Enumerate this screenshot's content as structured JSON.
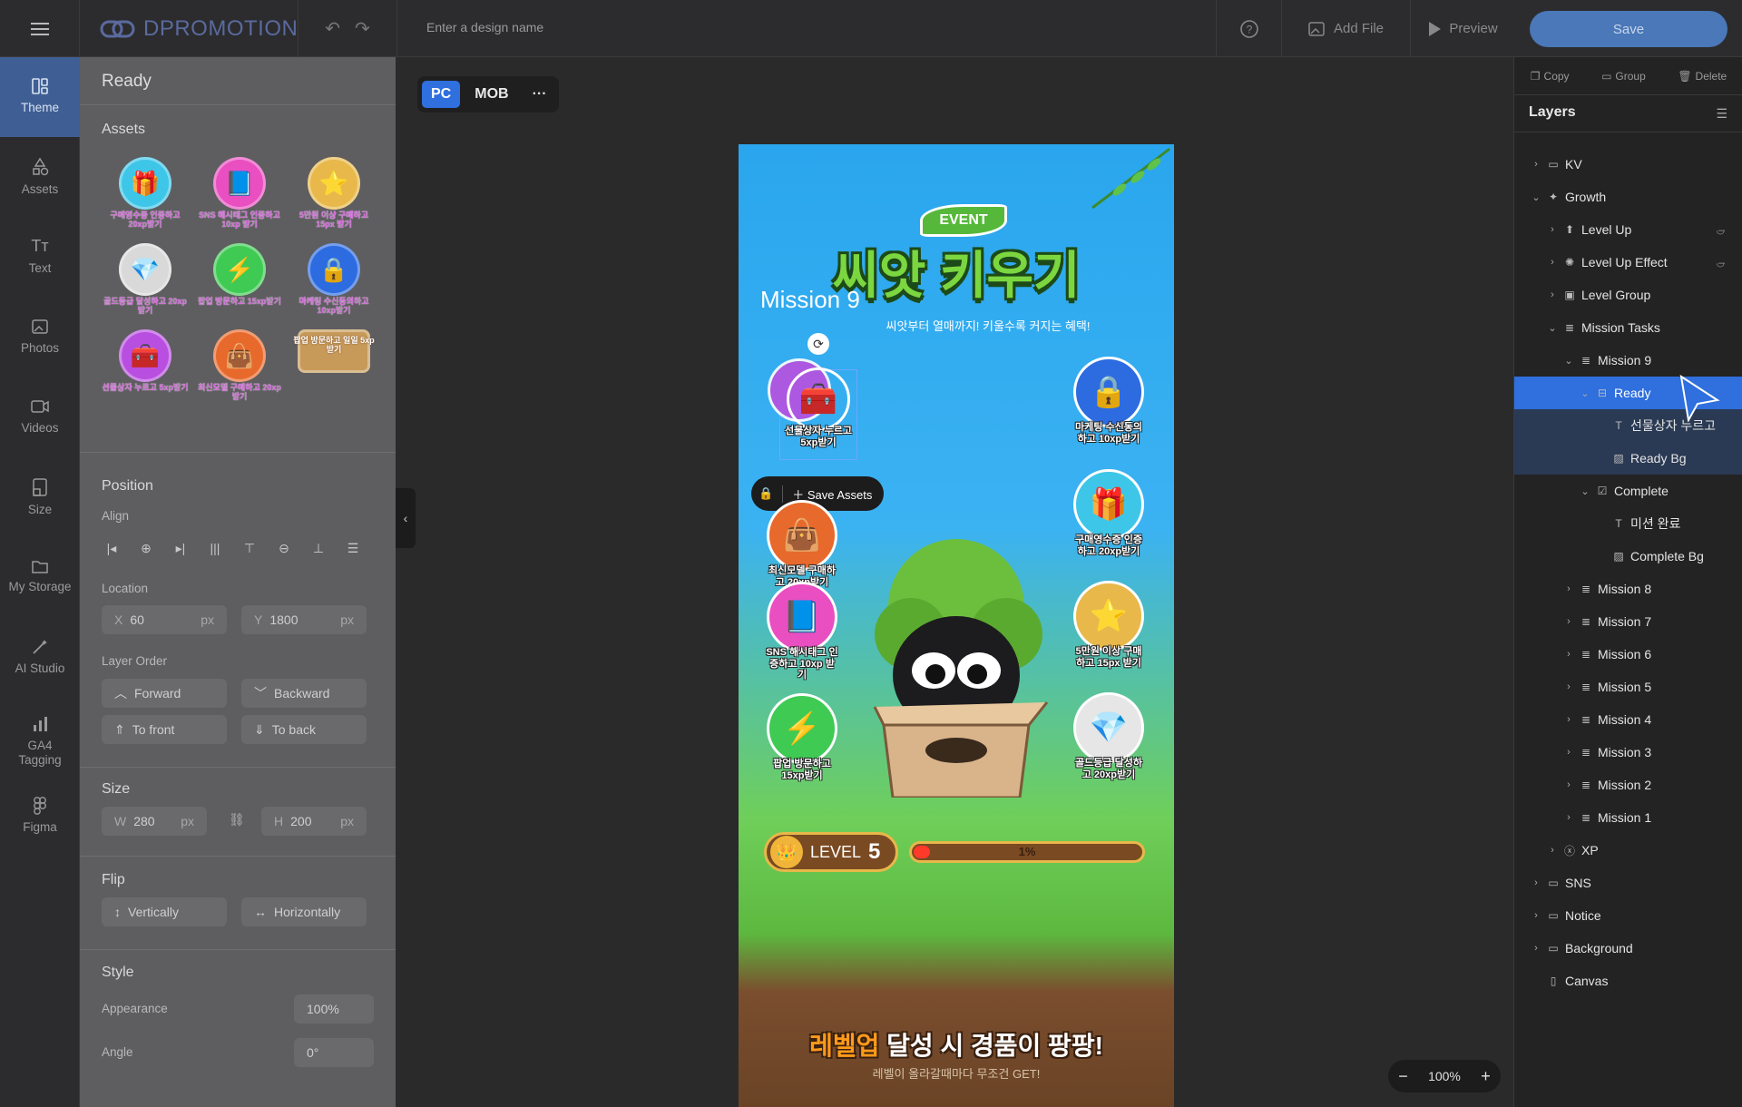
{
  "header": {
    "brand": "DPROMOTION",
    "design_name_placeholder": "Enter a design name",
    "add_file": "Add File",
    "preview": "Preview",
    "save": "Save"
  },
  "rail": [
    {
      "label": "Theme"
    },
    {
      "label": "Assets"
    },
    {
      "label": "Text"
    },
    {
      "label": "Photos"
    },
    {
      "label": "Videos"
    },
    {
      "label": "Size"
    },
    {
      "label": "My Storage"
    },
    {
      "label": "AI Studio"
    },
    {
      "label": "GA4 Tagging"
    },
    {
      "label": "Figma"
    }
  ],
  "panel": {
    "title": "Ready",
    "assets_heading": "Assets",
    "assets": [
      {
        "caption": "구매영수증 인증하고 20xp받기",
        "icon": "gift-icon",
        "color": "#3ec6e8"
      },
      {
        "caption": "SNS 해시태그 인증하고 10xp 받기",
        "icon": "book-icon",
        "color": "#e94fc1"
      },
      {
        "caption": "5만원 이상 구매하고 15px 받기",
        "icon": "star-coin-icon",
        "color": "#e8b84a"
      },
      {
        "caption": "골드등급 달성하고 20xp받기",
        "icon": "gem-icon",
        "color": "#d9d9d9"
      },
      {
        "caption": "팝업 방문하고 15xp받기",
        "icon": "lightning-icon",
        "color": "#3fca54"
      },
      {
        "caption": "마케팅 수신동의하고 10xp받기",
        "icon": "lock-icon",
        "color": "#2d6be0"
      },
      {
        "caption": "선물상자 누르고 5xp받기",
        "icon": "chest-icon",
        "color": "#b94fe0"
      },
      {
        "caption": "최신모델 구매하고 20xp받기",
        "icon": "bag-icon",
        "color": "#e8692c"
      },
      {
        "caption": "팝업 방문하고 일일 5xp 받기",
        "icon": "label-icon",
        "color": "#c79a5a"
      }
    ],
    "position_heading": "Position",
    "align_label": "Align",
    "location_label": "Location",
    "x": {
      "label": "X",
      "value": "60",
      "unit": "px"
    },
    "y": {
      "label": "Y",
      "value": "1800",
      "unit": "px"
    },
    "layer_order_label": "Layer Order",
    "forward": "Forward",
    "backward": "Backward",
    "to_front": "To front",
    "to_back": "To back",
    "size_heading": "Size",
    "w": {
      "label": "W",
      "value": "280",
      "unit": "px"
    },
    "h": {
      "label": "H",
      "value": "200",
      "unit": "px"
    },
    "flip_heading": "Flip",
    "vertically": "Vertically",
    "horizontally": "Horizontally",
    "style_heading": "Style",
    "appearance": {
      "label": "Appearance",
      "value": "100%"
    },
    "angle": {
      "label": "Angle",
      "value": "0°"
    }
  },
  "canvas": {
    "tabs": [
      "PC",
      "MOB"
    ],
    "event_badge": "EVENT",
    "title": "씨앗 키우기",
    "mission_label": "Mission 9",
    "subtitle": "씨앗부터 열매까지! 키울수록 커지는 혜택!",
    "save_assets": "Save Assets",
    "missions_left": [
      {
        "label": "선물상자 누르고 5xp받기",
        "icon": "chest-icon",
        "color": "#b94fe0"
      },
      {
        "label": "최신모델 구매하고 20xp받기",
        "icon": "bag-icon",
        "color": "#e8692c"
      },
      {
        "label": "SNS 해시태그 인증하고 10xp 받기",
        "icon": "book-icon",
        "color": "#e94fc1"
      },
      {
        "label": "팝업 방문하고 15xp받기",
        "icon": "lightning-icon",
        "color": "#3fca54"
      }
    ],
    "missions_right": [
      {
        "label": "마케팅 수신동의하고 10xp받기",
        "icon": "lock-icon",
        "color": "#2d6be0"
      },
      {
        "label": "구매영수증 인증하고 20xp받기",
        "icon": "gift-icon",
        "color": "#3ec6e8"
      },
      {
        "label": "5만원 이상 구매하고 15px 받기",
        "icon": "star-coin-icon",
        "color": "#e8b84a"
      },
      {
        "label": "골드등급 달성하고 20xp받기",
        "icon": "gem-icon",
        "color": "#d9d9d9"
      }
    ],
    "level_label": "LEVEL",
    "level_value": "5",
    "progress_text": "1%",
    "progress": 0.01,
    "footer_highlight": "레벨업",
    "footer_main": " 달성 시 경품이 팡팡!",
    "footer_sub": "레벨이 올라갈때마다 무조건 GET!",
    "zoom": "100%"
  },
  "layers_panel": {
    "actions": {
      "copy": "Copy",
      "group": "Group",
      "delete": "Delete"
    },
    "title": "Layers",
    "items": [
      {
        "label": "KV",
        "icon": "folder-icon",
        "indent": 0,
        "chev": ">"
      },
      {
        "label": "Growth",
        "icon": "sparkle-icon",
        "indent": 0,
        "chev": "v"
      },
      {
        "label": "Level Up",
        "icon": "rocket-icon",
        "indent": 1,
        "chev": ">",
        "hidden": true
      },
      {
        "label": "Level Up Effect",
        "icon": "burst-icon",
        "indent": 1,
        "chev": ">",
        "hidden": true
      },
      {
        "label": "Level Group",
        "icon": "frame-icon",
        "indent": 1,
        "chev": ">"
      },
      {
        "label": "Mission Tasks",
        "icon": "list-icon",
        "indent": 1,
        "chev": "v"
      },
      {
        "label": "Mission 9",
        "icon": "list-icon",
        "indent": 2,
        "chev": "v"
      },
      {
        "label": "Ready",
        "icon": "state-icon",
        "indent": 3,
        "chev": "v",
        "selected": true
      },
      {
        "label": "선물상자 누르고",
        "icon": "text-icon",
        "indent": 4,
        "chev": "",
        "subsel": true
      },
      {
        "label": "Ready Bg",
        "icon": "image-icon",
        "indent": 4,
        "chev": "",
        "subsel": true
      },
      {
        "label": "Complete",
        "icon": "check-icon",
        "indent": 3,
        "chev": "v"
      },
      {
        "label": "미션 완료",
        "icon": "text-icon",
        "indent": 4,
        "chev": ""
      },
      {
        "label": "Complete Bg",
        "icon": "image-icon",
        "indent": 4,
        "chev": ""
      },
      {
        "label": "Mission 8",
        "icon": "list-icon",
        "indent": 2,
        "chev": ">"
      },
      {
        "label": "Mission 7",
        "icon": "list-icon",
        "indent": 2,
        "chev": ">"
      },
      {
        "label": "Mission 6",
        "icon": "list-icon",
        "indent": 2,
        "chev": ">"
      },
      {
        "label": "Mission 5",
        "icon": "list-icon",
        "indent": 2,
        "chev": ">"
      },
      {
        "label": "Mission 4",
        "icon": "list-icon",
        "indent": 2,
        "chev": ">"
      },
      {
        "label": "Mission 3",
        "icon": "list-icon",
        "indent": 2,
        "chev": ">"
      },
      {
        "label": "Mission 2",
        "icon": "list-icon",
        "indent": 2,
        "chev": ">"
      },
      {
        "label": "Mission 1",
        "icon": "list-icon",
        "indent": 2,
        "chev": ">"
      },
      {
        "label": "XP",
        "icon": "xp-icon",
        "indent": 1,
        "chev": ">"
      },
      {
        "label": "SNS",
        "icon": "folder-icon",
        "indent": 0,
        "chev": ">"
      },
      {
        "label": "Notice",
        "icon": "folder-icon",
        "indent": 0,
        "chev": ">"
      },
      {
        "label": "Background",
        "icon": "folder-icon",
        "indent": 0,
        "chev": ">"
      },
      {
        "label": "Canvas",
        "icon": "canvas-icon",
        "indent": 0,
        "chev": ""
      }
    ]
  }
}
